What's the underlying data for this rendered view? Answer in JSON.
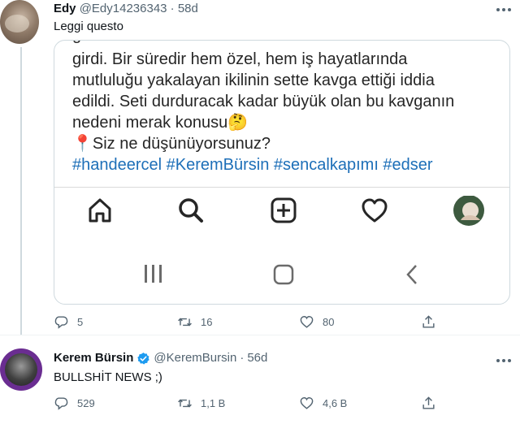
{
  "tweet1": {
    "name": "Edy",
    "handle": "@Edy14236343",
    "separator": "·",
    "time": "58d",
    "text": "Leggi questo",
    "embedded_post": {
      "cut_text": "g",
      "lines": [
        "girdi. Bir süredir hem özel, hem iş hayatlarında",
        "mutluluğu yakalayan ikilinin sette kavga ettiği iddia",
        "edildi. Seti durduracak kadar büyük olan bu kavganın",
        "nedeni merak konusu🤔",
        "📍Siz ne düşünüyorsunuz?"
      ],
      "hashtags": "#handeercel #KeremBürsin #sencalkapımı #edser"
    },
    "stats": {
      "replies": "5",
      "retweets": "16",
      "likes": "80"
    }
  },
  "tweet2": {
    "name": "Kerem Bürsin",
    "handle": "@KeremBursin",
    "separator": "·",
    "time": "56d",
    "text": "BULLSHİT NEWS ;)",
    "stats": {
      "replies": "529",
      "retweets": "1,1 B",
      "likes": "4,6 B"
    }
  },
  "colors": {
    "icon_gray": "#536471",
    "hashtag_blue": "#1d6fb8",
    "verified_blue": "#1d9bf0"
  }
}
